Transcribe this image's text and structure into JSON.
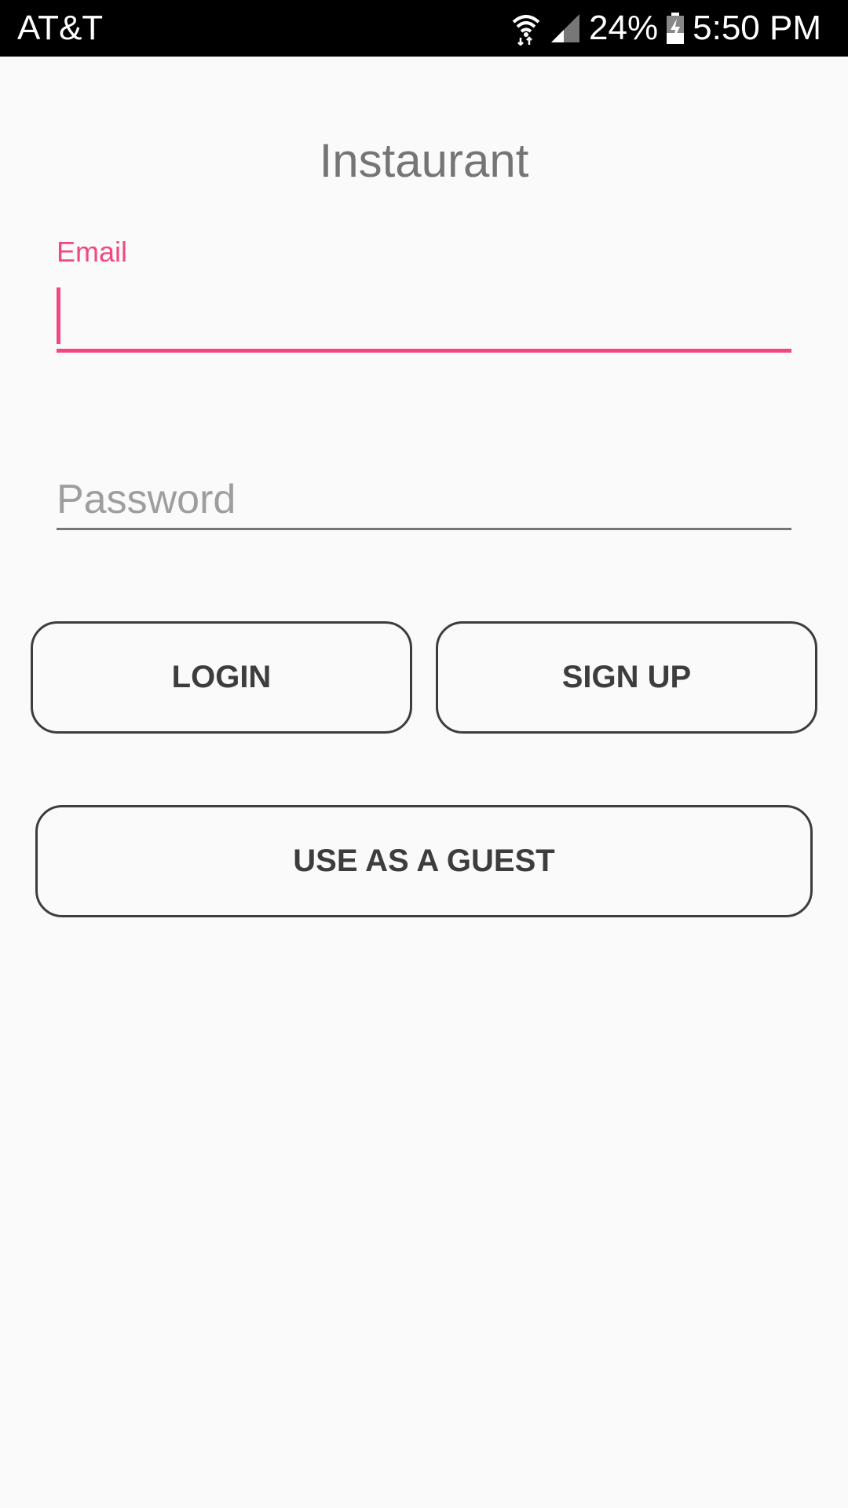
{
  "status_bar": {
    "carrier": "AT&T",
    "battery_percent": "24%",
    "time": "5:50 PM",
    "icons": [
      "wifi-icon",
      "signal-icon",
      "battery-charging-icon"
    ]
  },
  "app": {
    "title": "Instaurant"
  },
  "email_field": {
    "label": "Email",
    "value": "",
    "focused": true
  },
  "password_field": {
    "placeholder": "Password",
    "value": ""
  },
  "buttons": {
    "login": "LOGIN",
    "signup": "SIGN UP",
    "guest": "USE AS A GUEST"
  },
  "colors": {
    "accent": "#f2487f",
    "background": "#fafafa",
    "title": "#757575",
    "button_border": "#3d3d3d",
    "status_bar": "#000000"
  }
}
